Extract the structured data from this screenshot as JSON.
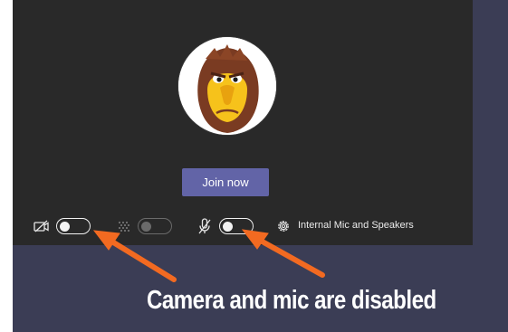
{
  "prejoin": {
    "avatar_icon": "hawk-mascot-avatar",
    "join_button_label": "Join now",
    "controls": {
      "camera": {
        "icon": "camera-off-icon",
        "state": "off"
      },
      "background_effects": {
        "icon": "background-blur-icon",
        "state": "off",
        "enabled": false
      },
      "microphone": {
        "icon": "mic-off-icon",
        "state": "off"
      },
      "device_settings": {
        "icon": "gear-icon",
        "label": "Internal Mic and Speakers"
      }
    }
  },
  "annotation": {
    "caption": "Camera and mic are disabled",
    "arrow_color": "#f26a21"
  },
  "colors": {
    "panel": "#292929",
    "backdrop": "#3b3d55",
    "accent": "#6264a7"
  }
}
